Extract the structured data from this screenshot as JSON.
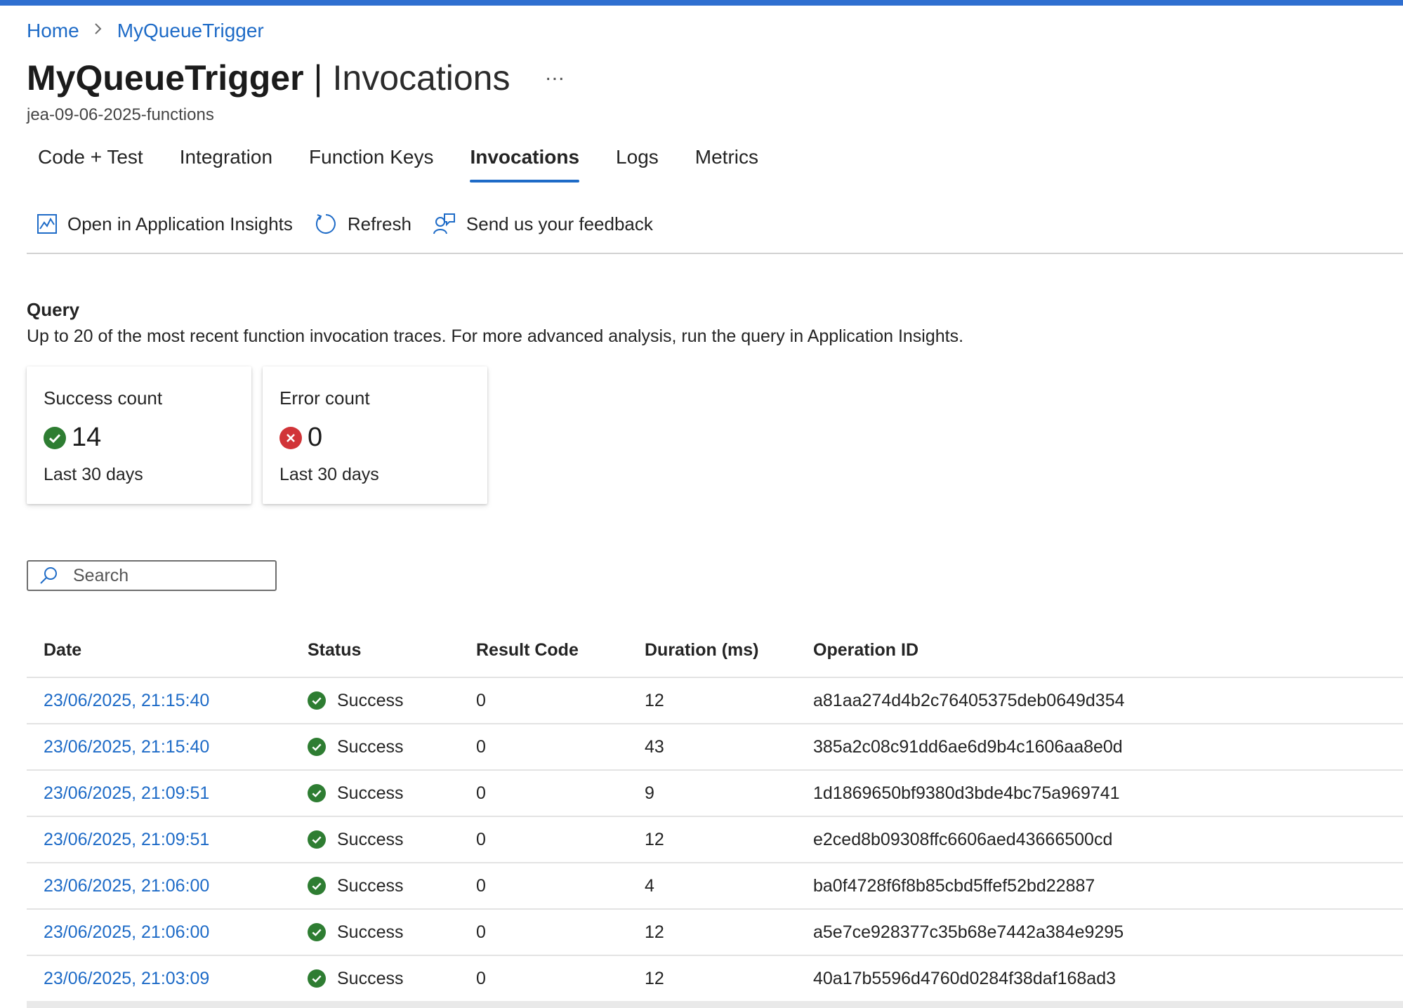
{
  "breadcrumb": {
    "home": "Home",
    "current": "MyQueueTrigger"
  },
  "header": {
    "title": "MyQueueTrigger",
    "divider": "|",
    "section": "Invocations",
    "more": "...",
    "subtitle": "jea-09-06-2025-functions"
  },
  "tabs": [
    {
      "label": "Code + Test"
    },
    {
      "label": "Integration"
    },
    {
      "label": "Function Keys"
    },
    {
      "label": "Invocations",
      "active": true
    },
    {
      "label": "Logs"
    },
    {
      "label": "Metrics"
    }
  ],
  "toolbar": {
    "app_insights": "Open in Application Insights",
    "refresh": "Refresh",
    "feedback": "Send us your feedback"
  },
  "query": {
    "heading": "Query",
    "description": "Up to 20 of the most recent function invocation traces. For more advanced analysis, run the query in Application Insights."
  },
  "cards": {
    "success": {
      "title": "Success count",
      "value": "14",
      "footer": "Last 30 days"
    },
    "error": {
      "title": "Error count",
      "value": "0",
      "footer": "Last 30 days"
    }
  },
  "search": {
    "placeholder": "Search",
    "value": ""
  },
  "table": {
    "columns": [
      "Date",
      "Status",
      "Result Code",
      "Duration (ms)",
      "Operation ID"
    ],
    "rows": [
      {
        "date": "23/06/2025, 21:15:40",
        "status": "Success",
        "code": "0",
        "duration": "12",
        "op": "a81aa274d4b2c76405375deb0649d354"
      },
      {
        "date": "23/06/2025, 21:15:40",
        "status": "Success",
        "code": "0",
        "duration": "43",
        "op": "385a2c08c91dd6ae6d9b4c1606aa8e0d"
      },
      {
        "date": "23/06/2025, 21:09:51",
        "status": "Success",
        "code": "0",
        "duration": "9",
        "op": "1d1869650bf9380d3bde4bc75a969741"
      },
      {
        "date": "23/06/2025, 21:09:51",
        "status": "Success",
        "code": "0",
        "duration": "12",
        "op": "e2ced8b09308ffc6606aed43666500cd"
      },
      {
        "date": "23/06/2025, 21:06:00",
        "status": "Success",
        "code": "0",
        "duration": "4",
        "op": "ba0f4728f6f8b85cbd5ffef52bd22887"
      },
      {
        "date": "23/06/2025, 21:06:00",
        "status": "Success",
        "code": "0",
        "duration": "12",
        "op": "a5e7ce928377c35b68e7442a384e9295"
      },
      {
        "date": "23/06/2025, 21:03:09",
        "status": "Success",
        "code": "0",
        "duration": "12",
        "op": "40a17b5596d4760d0284f38daf168ad3"
      }
    ]
  },
  "colors": {
    "accent": "#1e6bc7",
    "success": "#2e7d32",
    "error": "#d13438",
    "top_bar": "#2f6fd0"
  },
  "icons": {
    "breadcrumb_separator": "chevron-right-icon",
    "app_insights": "chart-icon",
    "refresh": "refresh-icon",
    "feedback": "feedback-icon",
    "success": "check-circle-icon",
    "error": "error-circle-icon",
    "search": "search-icon"
  }
}
